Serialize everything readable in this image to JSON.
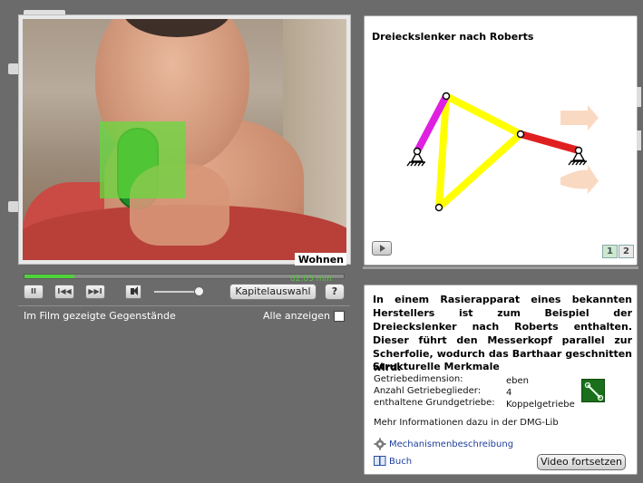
{
  "video": {
    "chapter_caption": "Wohnen",
    "time_label": "02:05 min",
    "progress_fraction": 0.155
  },
  "controls": {
    "pause_glyph": "II",
    "rewind_glyph": "I◀◀",
    "skip_glyph": "▶▶I",
    "chapter_button_label": "Kapitelauswahl",
    "help_button_label": "?",
    "volume_level": 0.8
  },
  "objects": {
    "label": "Im Film gezeigte Gegenstände",
    "show_all_label": "Alle anzeigen",
    "show_all_checked": false
  },
  "mechanism": {
    "title": "Dreieckslenker nach Roberts",
    "page_buttons": [
      "1",
      "2"
    ],
    "active_page": "1",
    "colors": {
      "crank": "#e020e0",
      "coupler": "#ffff00",
      "rocker": "#e02020",
      "arrow": "#f8c9a8"
    }
  },
  "info": {
    "description": "In einem Rasierapparat eines bekannten Herstellers ist zum Beispiel der Dreieckslenker nach Roberts enthalten. Dieser führt den Messerkopf parallel zur Scherfolie, wodurch das Barthaar geschnitten wird.",
    "features_heading": "Strukturelle Merkmale",
    "features": [
      {
        "label": "Getriebedimension:",
        "value": "eben"
      },
      {
        "label": "Anzahl Getriebeglieder:",
        "value": "4"
      },
      {
        "label": "enthaltene Grundgetriebe:",
        "value": "Koppelgetriebe"
      }
    ],
    "more_info": "Mehr Informationen dazu in der DMG-Lib",
    "mechanism_link": "Mechanismenbeschreibung",
    "book_link": "Buch",
    "continue_button": "Video fortsetzen"
  },
  "icons": [
    "pause-icon",
    "rewind-icon",
    "skip-forward-icon",
    "speaker-icon",
    "help-icon",
    "play-icon",
    "gear-icon",
    "book-icon",
    "linkage-icon"
  ]
}
